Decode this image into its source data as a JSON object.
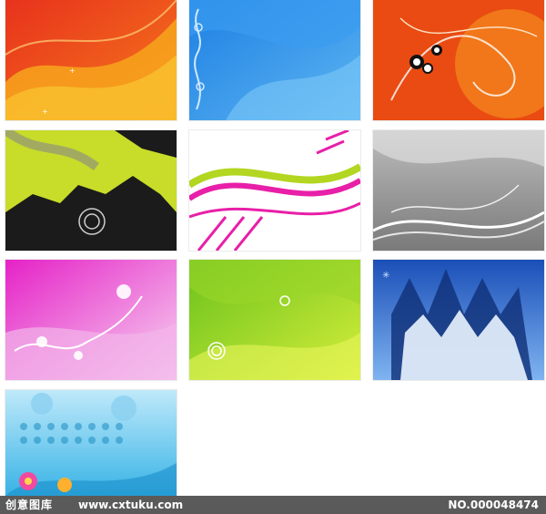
{
  "watermark": {
    "logo_text": "创意图库",
    "site_text": "www.cxtuku.com",
    "number_text": "NO.000048474"
  },
  "cards": [
    {
      "name": "orange-wave-card",
      "colors": [
        "#e8321d",
        "#f7a51c"
      ]
    },
    {
      "name": "blue-swirl-card",
      "colors": [
        "#1c7fe3",
        "#7cc8f7"
      ]
    },
    {
      "name": "orange-circles-card",
      "colors": [
        "#e94b12",
        "#f48a1e"
      ]
    },
    {
      "name": "green-splatter-card",
      "colors": [
        "#c8dc2a",
        "#1b1b1b"
      ]
    },
    {
      "name": "pink-green-stripes-card",
      "colors": [
        "#e81fa8",
        "#b3d621"
      ]
    },
    {
      "name": "gray-wave-card",
      "colors": [
        "#8a8a8a",
        "#e6e6e6"
      ]
    },
    {
      "name": "magenta-floral-card",
      "colors": [
        "#e522c7",
        "#f2b5ea"
      ]
    },
    {
      "name": "green-bubbles-card",
      "colors": [
        "#6ac21c",
        "#d6ee3b"
      ]
    },
    {
      "name": "blue-trees-card",
      "colors": [
        "#1b4fb8",
        "#7fb4f0"
      ]
    },
    {
      "name": "cyan-flowers-card",
      "colors": [
        "#37b3e6",
        "#bfe9fa"
      ]
    }
  ]
}
